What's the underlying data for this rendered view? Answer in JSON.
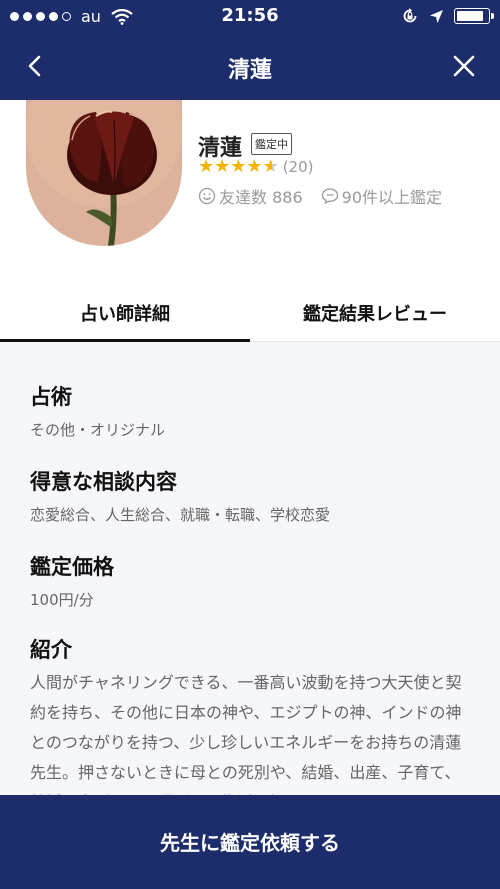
{
  "status_bar": {
    "carrier": "au",
    "time": "21:56",
    "signal_bars": 4,
    "signal_max": 5,
    "battery_level": 0.9,
    "icons": [
      "signal-dots",
      "wifi-icon",
      "rotation-lock-icon",
      "location-arrow-icon",
      "battery-icon"
    ]
  },
  "nav": {
    "title": "清蓮",
    "back_icon": "chevron-left-icon",
    "close_icon": "close-icon"
  },
  "profile": {
    "name": "清蓮",
    "badge": "鑑定中",
    "rating": 4.5,
    "rating_max": 5,
    "review_count": "(20)",
    "friends": "友達数 886",
    "readings": "90件以上鑑定",
    "avatar": "tulip-photo"
  },
  "tabs": [
    {
      "label": "占い師詳細",
      "active": true
    },
    {
      "label": "鑑定結果レビュー",
      "active": false
    }
  ],
  "details": {
    "divination_title": "占術",
    "divination_value": "その他・オリジナル",
    "specialty_title": "得意な相談内容",
    "specialty_value": "恋愛総合、人生総合、就職・転職、学校恋愛",
    "price_title": "鑑定価格",
    "price_value": "100円/分",
    "intro_title": "紹介",
    "intro_text": "人間がチャネリングできる、一番高い波動を持つ大天使と契約を持ち、その他に日本の神や、エジプトの神、インドの神とのつながりを持つ、少し珍しいエネルギーをお持ちの清蓮先生。押さないときに母との死別や、結婚、出産、子育て、離婚、乳がん、肝臓ガン、復活と振"
  },
  "cta": {
    "label": "先生に鑑定依頼する"
  },
  "colors": {
    "navy": "#1d2d6b",
    "star": "#f5b400",
    "muted_text": "#9a9a9a"
  }
}
